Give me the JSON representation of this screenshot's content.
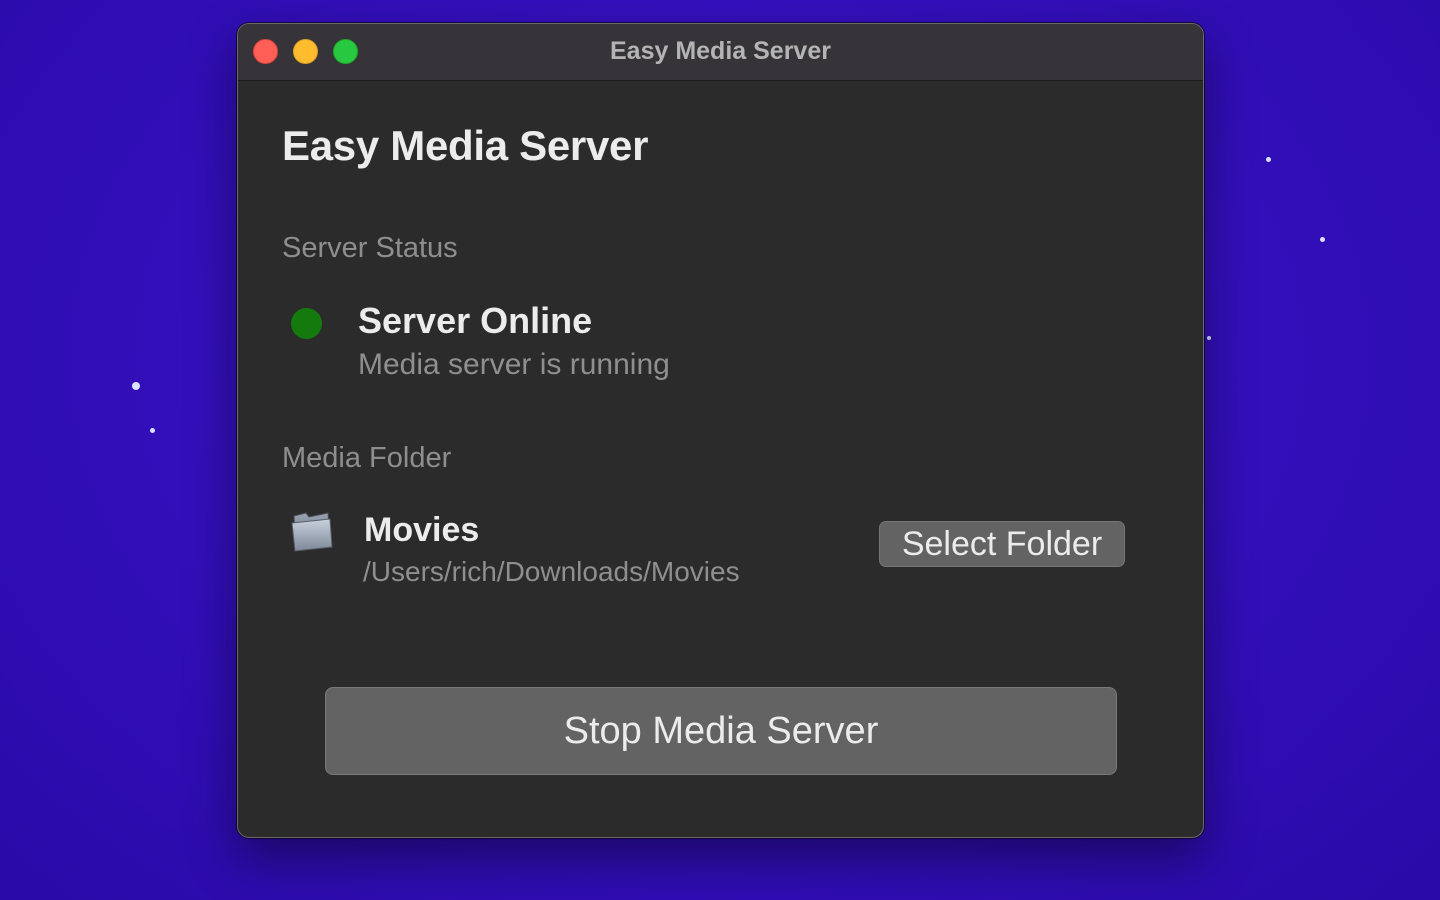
{
  "window": {
    "title": "Easy Media Server"
  },
  "app": {
    "title": "Easy Media Server"
  },
  "server_status": {
    "section_label": "Server Status",
    "state": "Server Online",
    "description": "Media server is running",
    "indicator_color": "#157a0e"
  },
  "media_folder": {
    "section_label": "Media Folder",
    "name": "Movies",
    "path": "/Users/rich/Downloads/Movies",
    "icon": "folder-icon",
    "select_label": "Select Folder"
  },
  "actions": {
    "stop_label": "Stop Media Server"
  },
  "colors": {
    "window_bg": "#2b2b2b",
    "titlebar_bg": "#363438",
    "button_bg": "#636363",
    "desktop_bg": "#3410be"
  }
}
